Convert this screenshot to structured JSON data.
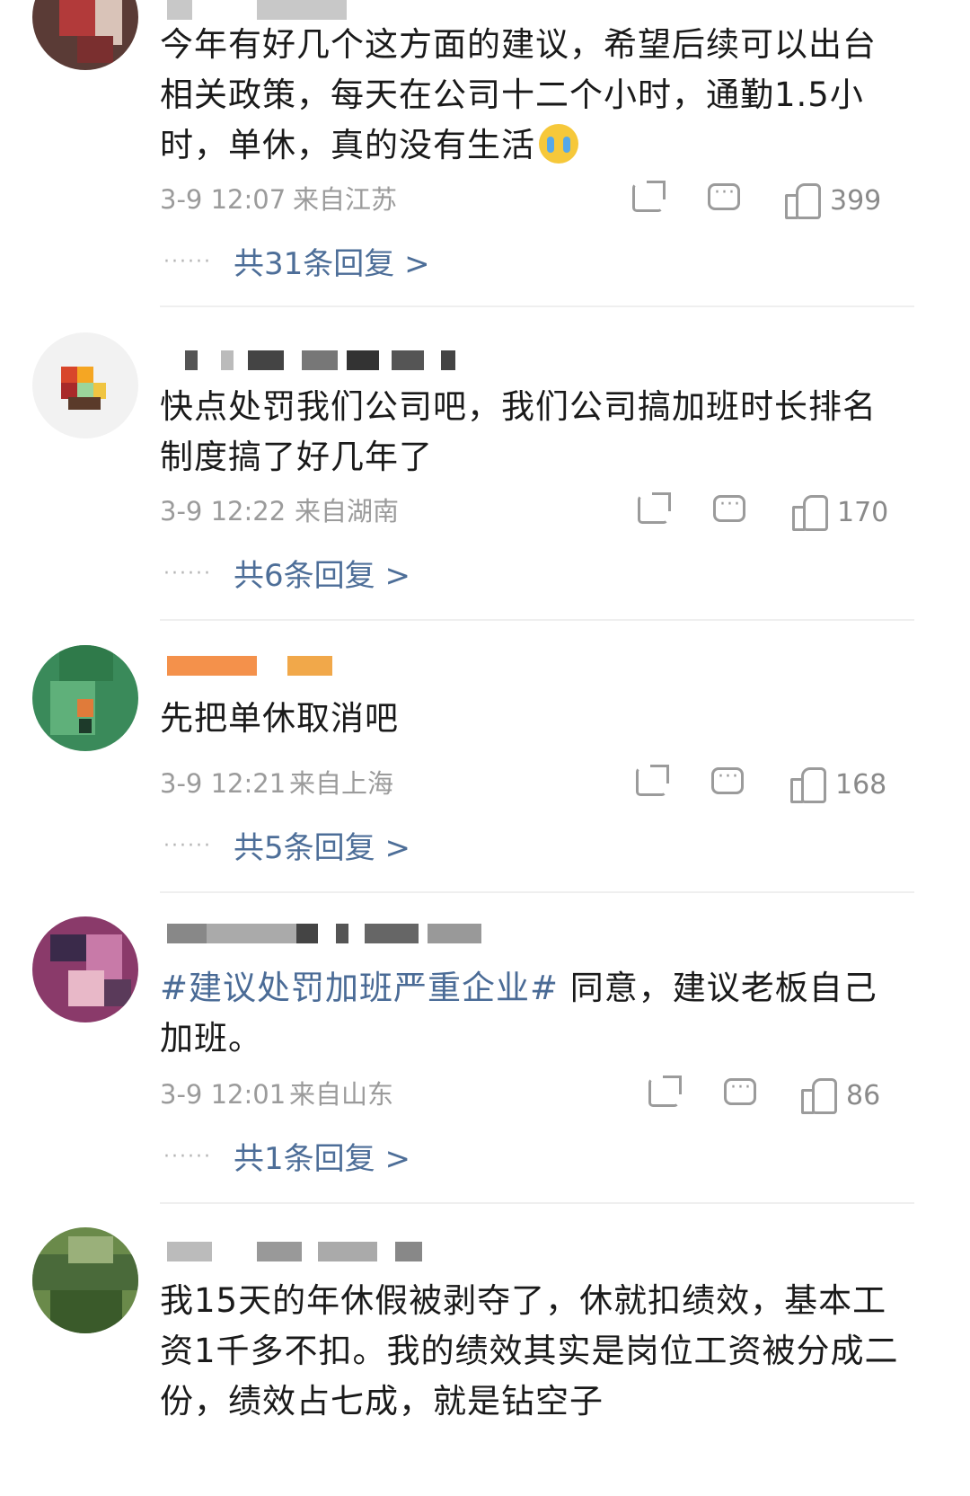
{
  "comments": [
    {
      "text": "今年有好几个这方面的建议，希望后续可以出台相关政策，每天在公司十二个小时，通勤1.5小时，单休，真的没有生活",
      "emoji": "crying-face-emoji",
      "time": "3-9 12:07",
      "location": "来自江苏",
      "likes": "399",
      "replies": "共31条回复 >"
    },
    {
      "text": "快点处罚我们公司吧，我们公司搞加班时长排名制度搞了好几年了",
      "time": "3-9 12:22",
      "location": "来自湖南",
      "likes": "170",
      "replies": "共6条回复 >"
    },
    {
      "text": "先把单休取消吧",
      "time": "3-9 12:21",
      "location": "来自上海",
      "likes": "168",
      "replies": "共5条回复 >"
    },
    {
      "hashtag": "#建议处罚加班严重企业#",
      "text": " 同意，建议老板自己加班。",
      "time": "3-9 12:01",
      "location": "来自山东",
      "likes": "86",
      "replies": "共1条回复 >"
    },
    {
      "text": "我15天的年休假被剥夺了，休就扣绩效，基本工资1千多不扣。我的绩效其实是岗位工资被分成二份，绩效占七成，就是钻空子"
    }
  ],
  "dots": "······",
  "colors": {
    "link": "#4d6e98",
    "meta": "#9b9b9b",
    "text": "#1a1a1a"
  }
}
